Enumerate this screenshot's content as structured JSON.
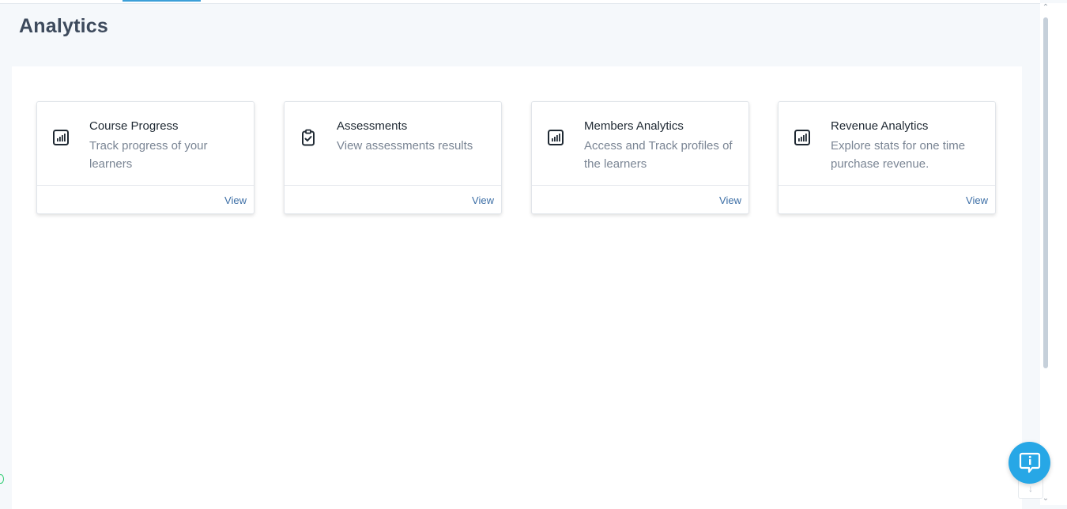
{
  "page": {
    "title": "Analytics"
  },
  "cards": [
    {
      "title": "Course Progress",
      "description": "Track progress of your learners",
      "icon": "bar-chart-icon",
      "action": "View"
    },
    {
      "title": "Assessments",
      "description": "View assessments results",
      "icon": "clipboard-check-icon",
      "action": "View"
    },
    {
      "title": "Members Analytics",
      "description": "Access and Track profiles of the learners",
      "icon": "bar-chart-icon",
      "action": "View"
    },
    {
      "title": "Revenue Analytics",
      "description": "Explore stats for one time purchase revenue.",
      "icon": "bar-chart-icon",
      "action": "View"
    }
  ],
  "help": {
    "icon": "info-chat-icon"
  },
  "colors": {
    "accent": "#27a7e6",
    "link": "#3d6fa6",
    "background": "#f5f8fb",
    "title_text": "#3d4a5c"
  }
}
